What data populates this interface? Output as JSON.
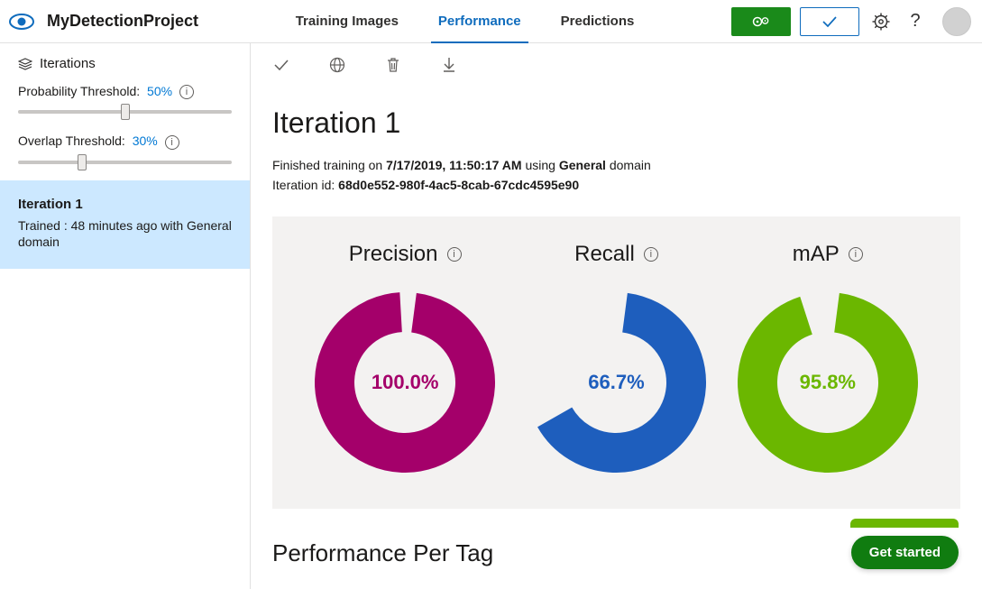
{
  "header": {
    "project_name": "MyDetectionProject",
    "tabs": [
      {
        "label": "Training Images",
        "active": false
      },
      {
        "label": "Performance",
        "active": true
      },
      {
        "label": "Predictions",
        "active": false
      }
    ]
  },
  "sidebar": {
    "heading": "Iterations",
    "thresholds": [
      {
        "label": "Probability Threshold:",
        "value": "50%",
        "percent": 50
      },
      {
        "label": "Overlap Threshold:",
        "value": "30%",
        "percent": 30
      }
    ],
    "iterations": [
      {
        "title": "Iteration 1",
        "subtitle": "Trained : 48 minutes ago with General domain",
        "selected": true
      }
    ]
  },
  "content": {
    "iteration_title": "Iteration 1",
    "finished_prefix": "Finished training on ",
    "finished_datetime": "7/17/2019, 11:50:17 AM",
    "finished_mid": " using ",
    "finished_domain": "General",
    "finished_suffix": " domain",
    "iteration_id_label": "Iteration id: ",
    "iteration_id": "68d0e552-980f-4ac5-8cab-67cdc4595e90",
    "perf_per_tag": "Performance Per Tag",
    "get_started": "Get started"
  },
  "chart_data": [
    {
      "type": "pie",
      "title": "Precision",
      "value": 100.0,
      "display": "100.0%",
      "color": "#a4006a"
    },
    {
      "type": "pie",
      "title": "Recall",
      "value": 66.7,
      "display": "66.7%",
      "color": "#1e5ebd"
    },
    {
      "type": "pie",
      "title": "mAP",
      "value": 95.8,
      "display": "95.8%",
      "color": "#6bb700"
    }
  ]
}
